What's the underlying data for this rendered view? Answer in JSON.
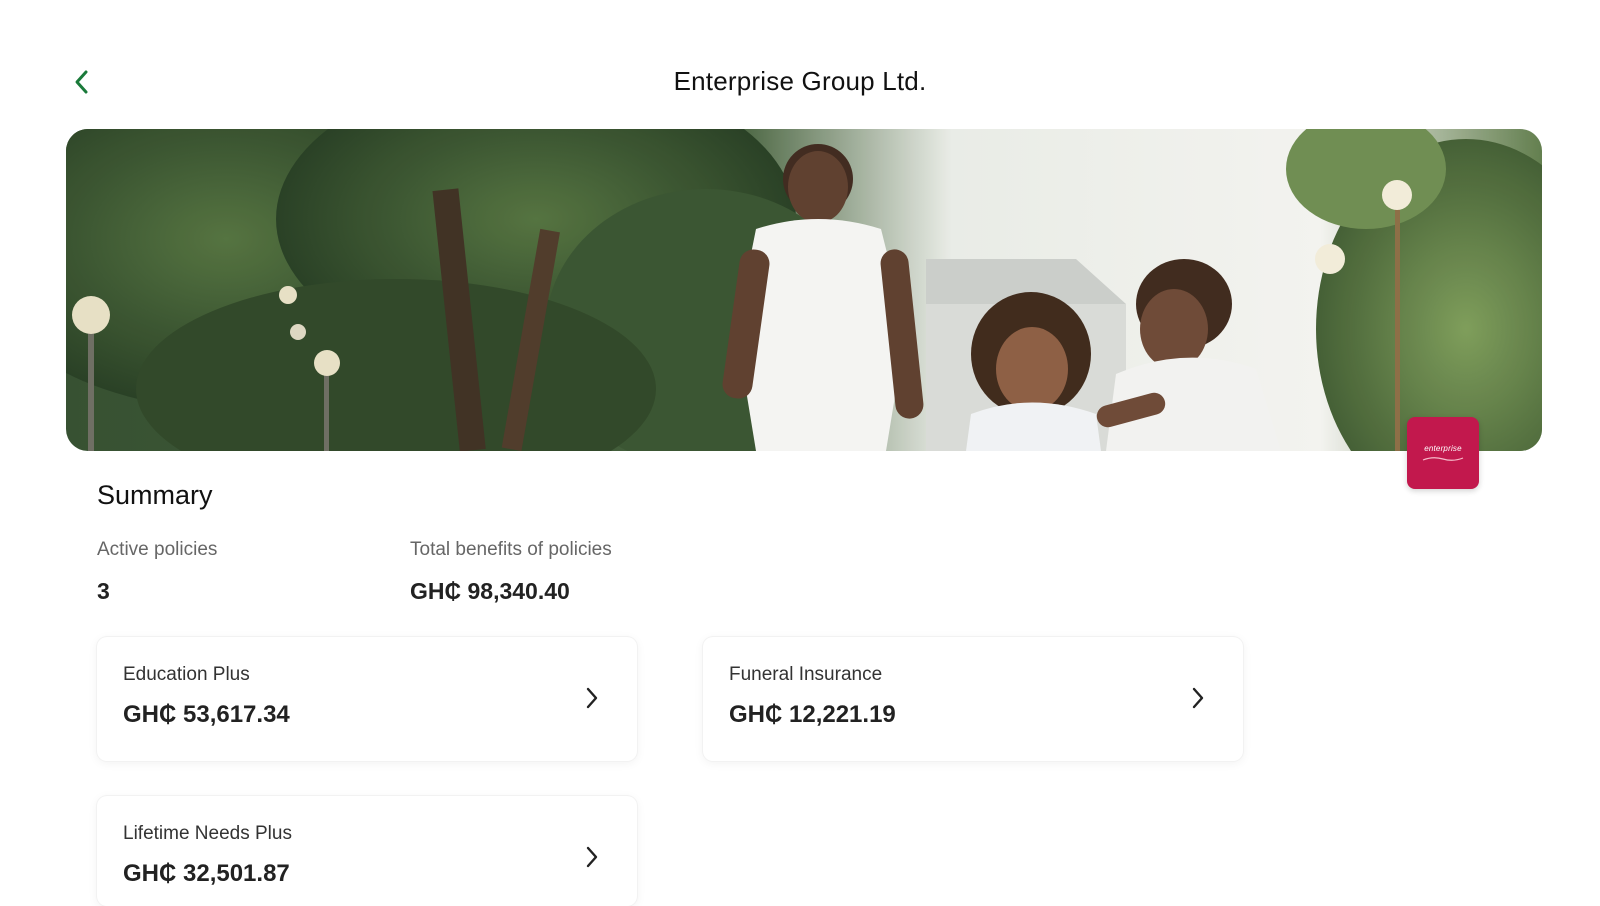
{
  "header": {
    "title": "Enterprise Group Ltd.",
    "back_icon": "chevron-left-icon",
    "back_color": "#1a7a3a"
  },
  "banner": {
    "image": "family-walking-in-park-photo"
  },
  "brand_badge": {
    "logo_text": "enterprise",
    "color": "#c2184d"
  },
  "summary": {
    "title": "Summary",
    "active_policies_label": "Active policies",
    "active_policies_value": "3",
    "total_benefits_label": "Total benefits of policies",
    "total_benefits_value": "GH₵ 98,340.40"
  },
  "policies": [
    {
      "name": "Education Plus",
      "amount": "GH₵ 53,617.34"
    },
    {
      "name": "Funeral Insurance",
      "amount": "GH₵ 12,221.19"
    },
    {
      "name": "Lifetime Needs Plus",
      "amount": "GH₵ 32,501.87"
    }
  ]
}
